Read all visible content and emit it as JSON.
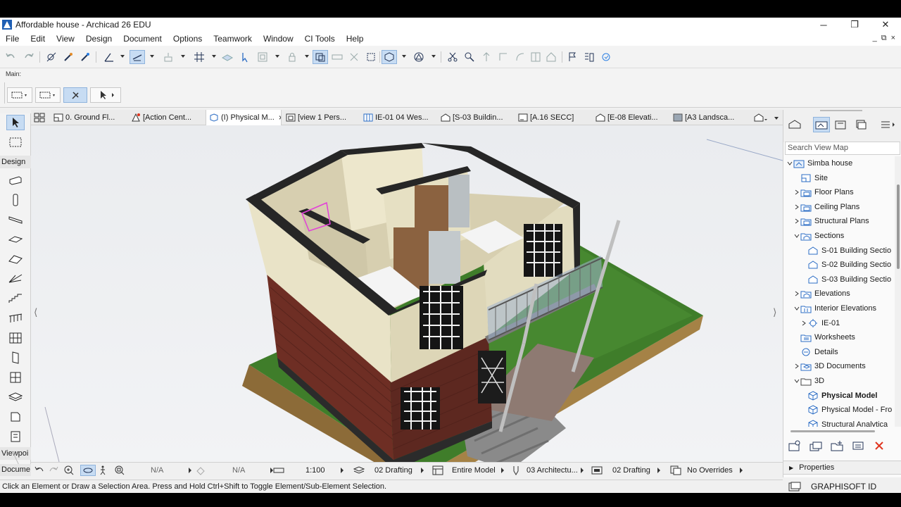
{
  "window": {
    "title": "Affordable house - Archicad 26 EDU",
    "minimize": "─",
    "maximize": "❐",
    "close": "✕"
  },
  "menu": [
    "File",
    "Edit",
    "View",
    "Design",
    "Document",
    "Options",
    "Teamwork",
    "Window",
    "CI Tools",
    "Help"
  ],
  "menu_right": [
    "_",
    "⧉",
    "×"
  ],
  "infobox": {
    "label": "Main:"
  },
  "toolbox": {
    "design_label": "Design",
    "viewpoint_label": "Viewpoi",
    "document_label": "Docume"
  },
  "tabs": [
    {
      "label": "0. Ground Fl...",
      "icon": "floor-plan-icon"
    },
    {
      "label": "[Action Cent...",
      "icon": "action-center-icon"
    },
    {
      "label": "(I) Physical M...",
      "icon": "3d-window-icon",
      "active": true
    },
    {
      "label": "[view 1 Pers...",
      "icon": "perspective-icon"
    },
    {
      "label": "IE-01 04 Wes...",
      "icon": "interior-elevation-icon"
    },
    {
      "label": "[S-03 Buildin...",
      "icon": "section-icon"
    },
    {
      "label": "[A.16 SECC]",
      "icon": "layout-icon"
    },
    {
      "label": "[E-08 Elevati...",
      "icon": "elevation-icon"
    },
    {
      "label": "[A3 Landsca...",
      "icon": "layout-icon"
    }
  ],
  "tab_close": "×",
  "quick_options": {
    "zoom_value1": "N/A",
    "zoom_value2": "N/A",
    "scale": "1:100",
    "layer_combo": "02 Drafting",
    "model_view": "Entire Model",
    "pen_set": "03 Architectu...",
    "graphic_override": "02 Drafting",
    "renovation": "No Overrides"
  },
  "status": "Click an Element or Draw a Selection Area. Press and Hold Ctrl+Shift to Toggle Element/Sub-Element Selection.",
  "navigator": {
    "search_placeholder": "Search View Map",
    "tree": [
      {
        "label": "Simba house",
        "level": 0,
        "exp": "open",
        "icon": "project-icon"
      },
      {
        "label": "Site",
        "level": 1,
        "exp": "none",
        "icon": "floor-plan-icon"
      },
      {
        "label": "Floor Plans",
        "level": 1,
        "exp": "closed",
        "icon": "folder-plan-icon"
      },
      {
        "label": "Ceiling Plans",
        "level": 1,
        "exp": "closed",
        "icon": "folder-plan-icon"
      },
      {
        "label": "Structural Plans",
        "level": 1,
        "exp": "closed",
        "icon": "folder-plan-icon"
      },
      {
        "label": "Sections",
        "level": 1,
        "exp": "open",
        "icon": "folder-section-icon"
      },
      {
        "label": "S-01 Building Sectio",
        "level": 2,
        "exp": "none",
        "icon": "section-icon"
      },
      {
        "label": "S-02 Building Sectio",
        "level": 2,
        "exp": "none",
        "icon": "section-icon"
      },
      {
        "label": "S-03 Building Sectio",
        "level": 2,
        "exp": "none",
        "icon": "section-icon"
      },
      {
        "label": "Elevations",
        "level": 1,
        "exp": "closed",
        "icon": "folder-elevation-icon"
      },
      {
        "label": "Interior Elevations",
        "level": 1,
        "exp": "open",
        "icon": "folder-ie-icon"
      },
      {
        "label": "IE-01",
        "level": 2,
        "exp": "closed",
        "icon": "ie-marker-icon"
      },
      {
        "label": "Worksheets",
        "level": 1,
        "exp": "none",
        "icon": "worksheet-icon"
      },
      {
        "label": "Details",
        "level": 1,
        "exp": "none",
        "icon": "detail-icon"
      },
      {
        "label": "3D Documents",
        "level": 1,
        "exp": "closed",
        "icon": "folder-3d-doc-icon"
      },
      {
        "label": "3D",
        "level": 1,
        "exp": "open",
        "icon": "folder-icon"
      },
      {
        "label": "Physical Model",
        "level": 2,
        "exp": "none",
        "icon": "cube-icon",
        "bold": true
      },
      {
        "label": "Physical Model - Fro",
        "level": 2,
        "exp": "none",
        "icon": "cube-icon"
      },
      {
        "label": "Structural Analytica",
        "level": 2,
        "exp": "none",
        "icon": "cube-icon"
      }
    ],
    "properties_label": "Properties",
    "footer": "GRAPHISOFT ID"
  },
  "colors": {
    "accent": "#c7dcf3",
    "grass": "#3f7d2a",
    "brick": "#6e2e24",
    "plaster": "#e9e3c7",
    "delete": "#e0341e"
  }
}
